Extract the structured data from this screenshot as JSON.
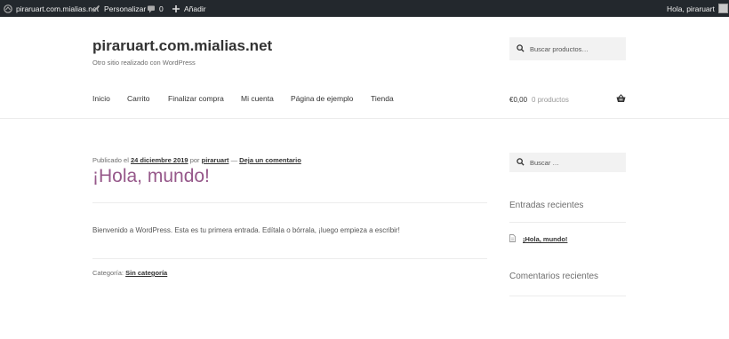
{
  "adminbar": {
    "site": "piraruart.com.mialias.net",
    "customize": "Personalizar",
    "comments_count": "0",
    "add_new": "Añadir",
    "greeting": "Hola, piraruart"
  },
  "header": {
    "site_title": "piraruart.com.mialias.net",
    "tagline": "Otro sitio realizado con WordPress",
    "search_placeholder": "Buscar productos…"
  },
  "nav": {
    "items": [
      "Inicio",
      "Carrito",
      "Finalizar compra",
      "Mi cuenta",
      "Página de ejemplo",
      "Tienda"
    ]
  },
  "cart": {
    "amount": "€0,00",
    "count": "0 productos"
  },
  "post": {
    "published_label": "Publicado el",
    "date": "24 diciembre 2019",
    "by_label": "por",
    "author": "piraruart",
    "separator": "—",
    "comment_link": "Deja un comentario",
    "title": "¡Hola, mundo!",
    "body": "Bienvenido a WordPress. Esta es tu primera entrada. Edítala o bórrala, ¡luego empieza a escribir!",
    "category_label": "Categoría:",
    "category": "Sin categoría"
  },
  "sidebar": {
    "search_placeholder": "Buscar …",
    "recent_posts_title": "Entradas recientes",
    "recent_posts": [
      "¡Hola, mundo!"
    ],
    "recent_comments_title": "Comentarios recientes"
  },
  "colors": {
    "adminbar_bg": "#23282d",
    "title_purple": "#96588a",
    "field_bg": "#f2f2f2"
  }
}
